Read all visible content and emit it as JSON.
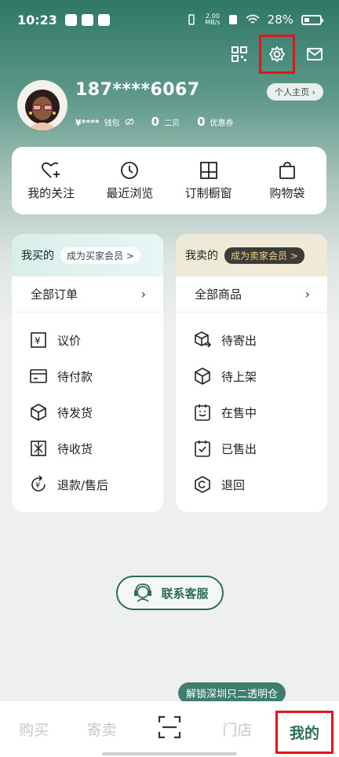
{
  "status_bar": {
    "time": "10:23",
    "net_speed": "2.00",
    "net_unit": "MB/s",
    "battery": "28%"
  },
  "profile": {
    "phone": "187****6067",
    "homepage_label": "个人主页",
    "wallet_value": "¥****",
    "wallet_label": "钱包",
    "second_value": "0",
    "second_label": "二贝",
    "coupon_value": "0",
    "coupon_label": "优惠券"
  },
  "shortcuts": [
    {
      "label": "我的关注",
      "icon": "heart-plus-icon"
    },
    {
      "label": "最近浏览",
      "icon": "clock-icon"
    },
    {
      "label": "订制橱窗",
      "icon": "window-icon"
    },
    {
      "label": "购物袋",
      "icon": "bag-icon"
    }
  ],
  "buy_panel": {
    "title": "我买的",
    "member": "成为买家会员 >",
    "all": "全部订单",
    "items": [
      "议价",
      "待付款",
      "待发货",
      "待收货",
      "退款/售后"
    ]
  },
  "sell_panel": {
    "title": "我卖的",
    "member": "成为卖家会员 >",
    "all": "全部商品",
    "items": [
      "待寄出",
      "待上架",
      "在售中",
      "已售出",
      "退回"
    ]
  },
  "service": {
    "label": "联系客服"
  },
  "tooltip": "解锁深圳只二透明仓",
  "nav": {
    "buy": "购买",
    "consign": "寄卖",
    "store": "门店",
    "mine": "我的"
  },
  "colors": {
    "accent": "#2c6b5b",
    "highlight": "#e0161b"
  }
}
